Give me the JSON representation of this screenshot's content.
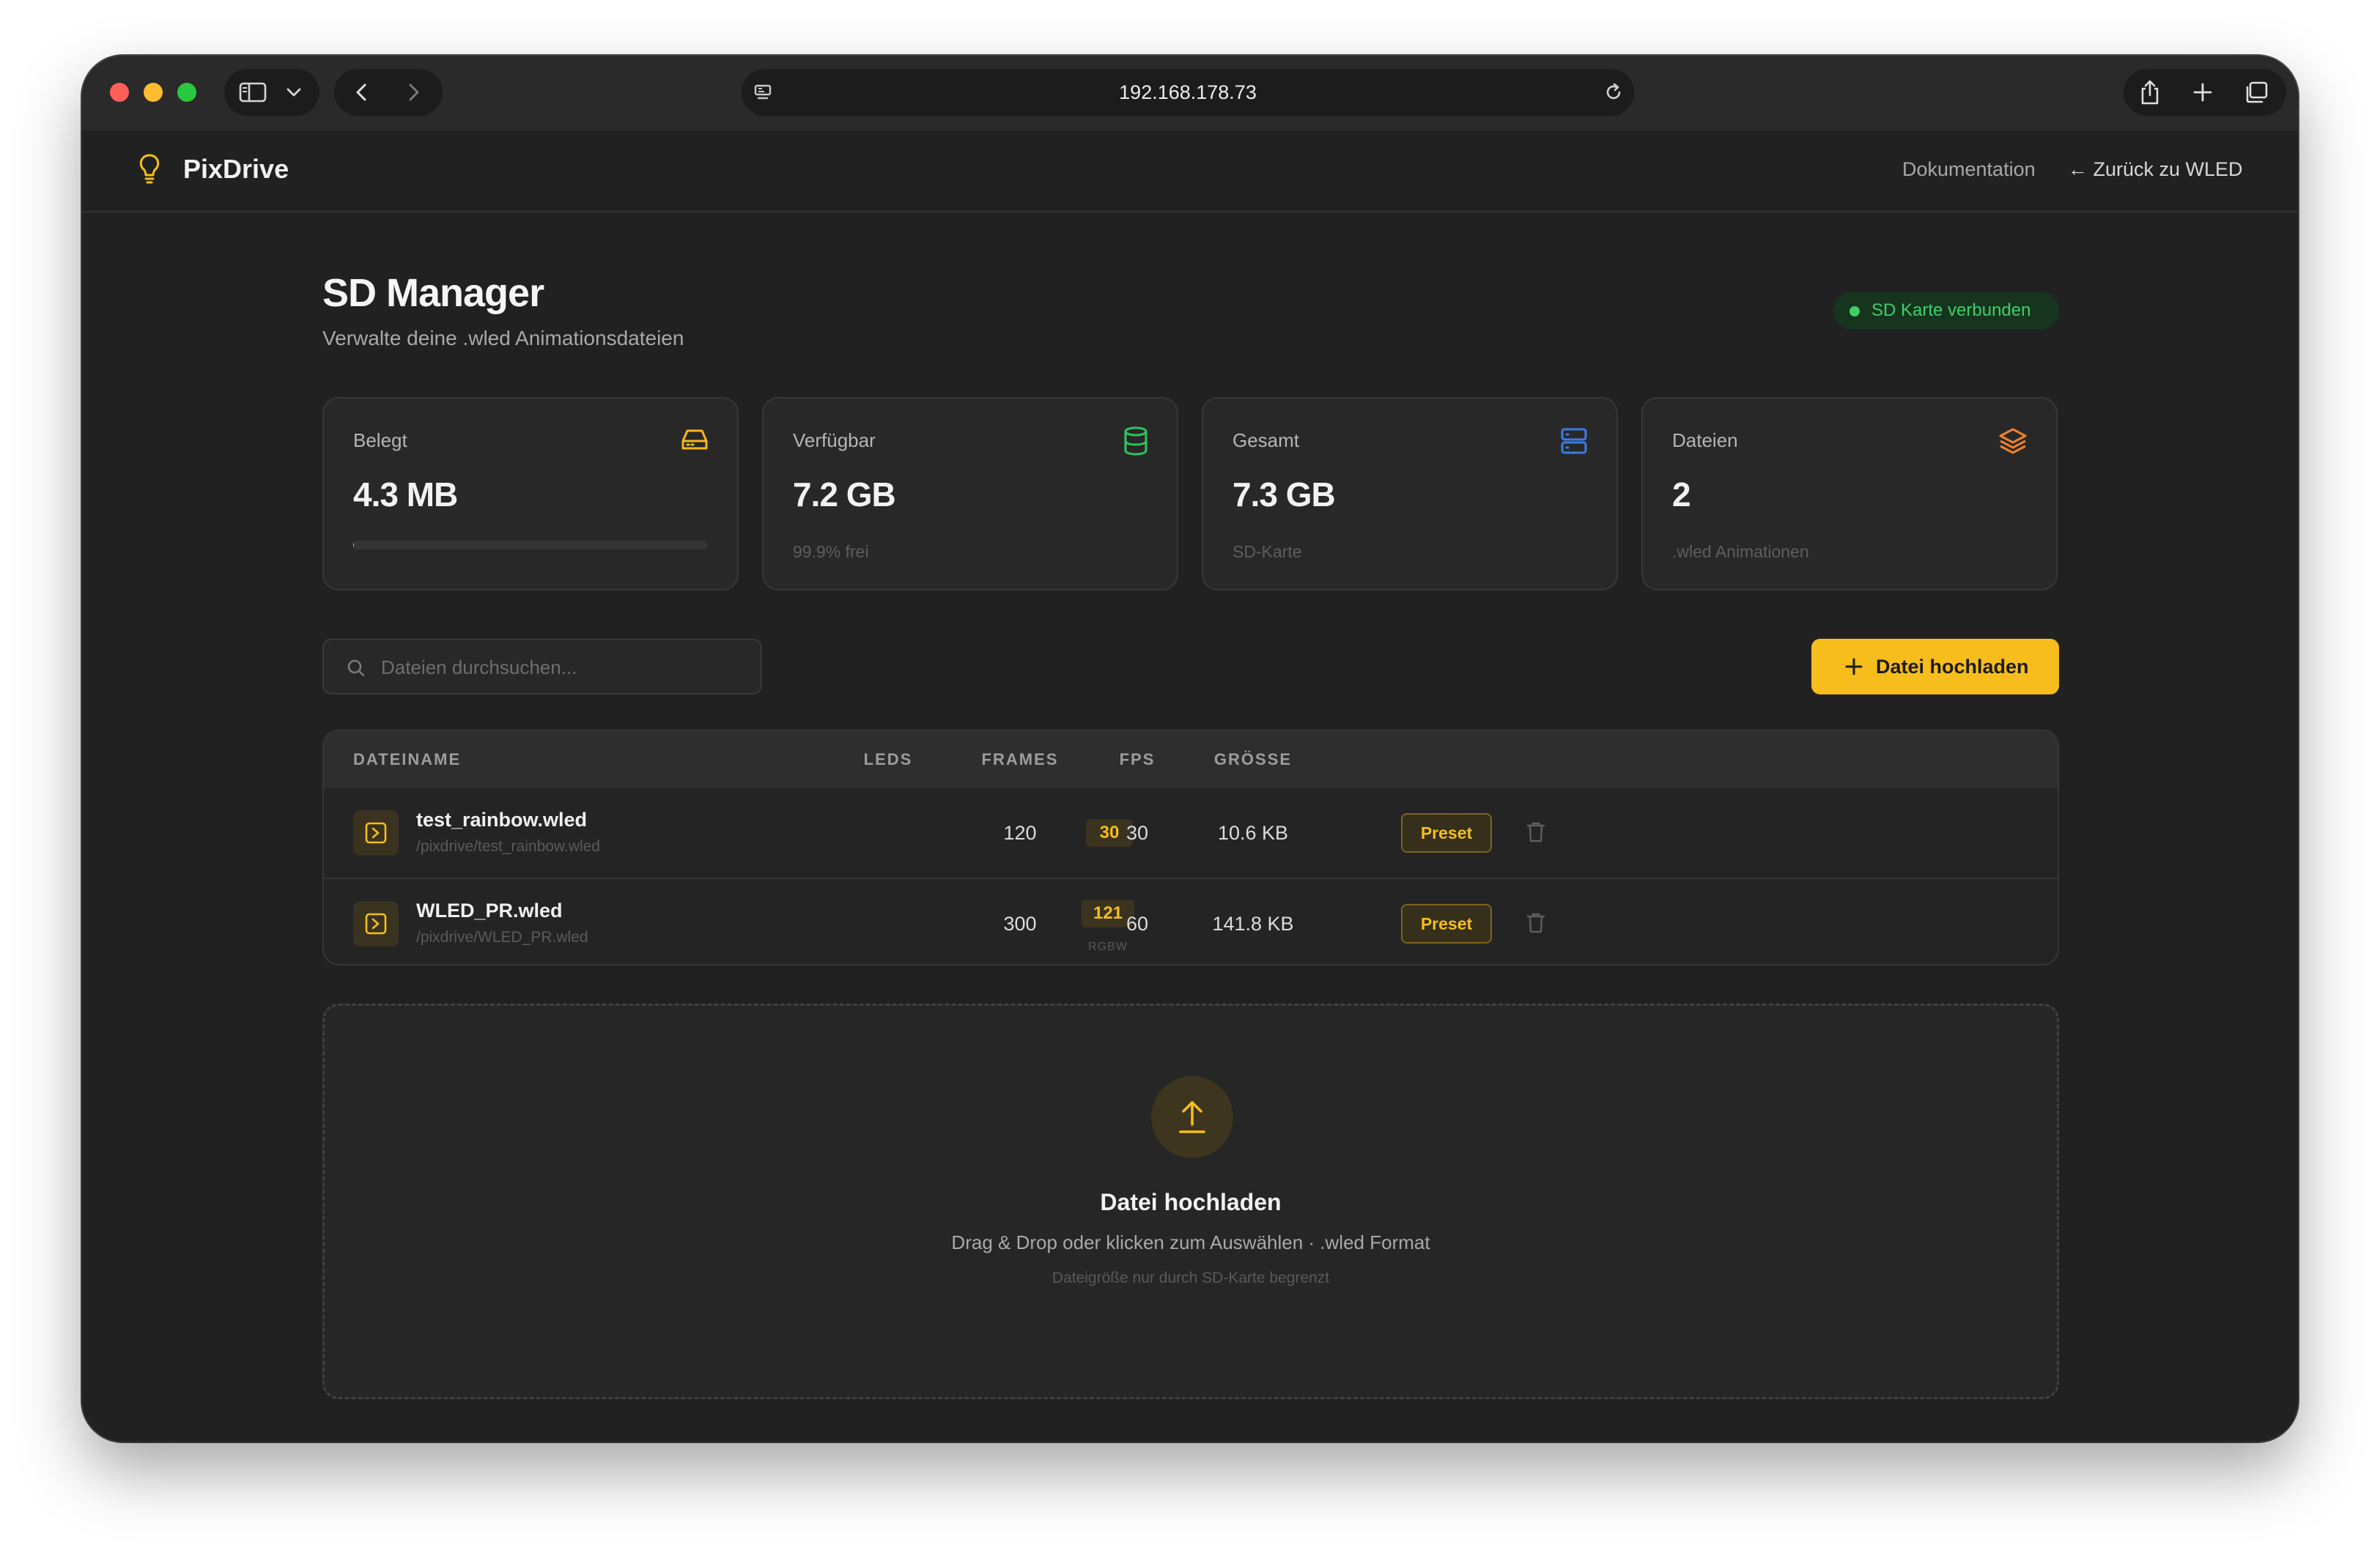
{
  "browser": {
    "url": "192.168.178.73"
  },
  "header": {
    "brand": "PixDrive",
    "docs_link": "Dokumentation",
    "back_link": "← Zurück zu WLED"
  },
  "page": {
    "title": "SD Manager",
    "subtitle": "Verwalte deine .wled Animationsdateien",
    "status": "SD Karte verbunden"
  },
  "stats": [
    {
      "label": "Belegt",
      "value": "4.3 MB",
      "sub": "",
      "icon": "hard-drive-icon",
      "color": "#f5b81c",
      "usage_fraction": 0.001
    },
    {
      "label": "Verfügbar",
      "value": "7.2 GB",
      "sub": "99.9% frei",
      "icon": "database-icon",
      "color": "#2fc45f"
    },
    {
      "label": "Gesamt",
      "value": "7.3 GB",
      "sub": "SD-Karte",
      "icon": "server-icon",
      "color": "#3d7be6"
    },
    {
      "label": "Dateien",
      "value": "2",
      "sub": ".wled Animationen",
      "icon": "layers-icon",
      "color": "#f0822a"
    }
  ],
  "toolbar": {
    "search_placeholder": "Dateien durchsuchen...",
    "upload_label": "Datei hochladen"
  },
  "table": {
    "columns": [
      "DATEINAME",
      "LEDS",
      "FRAMES",
      "FPS",
      "GRÖSSE"
    ],
    "rows": [
      {
        "name": "test_rainbow.wled",
        "path": "/pixdrive/test_rainbow.wled",
        "leds": "30",
        "led_type": "",
        "frames": "120",
        "fps": "30",
        "size": "10.6 KB",
        "action": "Preset"
      },
      {
        "name": "WLED_PR.wled",
        "path": "/pixdrive/WLED_PR.wled",
        "leds": "121",
        "led_type": "RGBW",
        "frames": "300",
        "fps": "60",
        "size": "141.8 KB",
        "action": "Preset"
      }
    ]
  },
  "dropzone": {
    "title": "Datei hochladen",
    "description": "Drag & Drop oder klicken zum Auswählen · .wled Format",
    "note": "Dateigröße nur durch SD-Karte begrenzt"
  },
  "colors": {
    "accent": "#f6bd1c",
    "success": "#3dd068",
    "background": "#212121"
  }
}
